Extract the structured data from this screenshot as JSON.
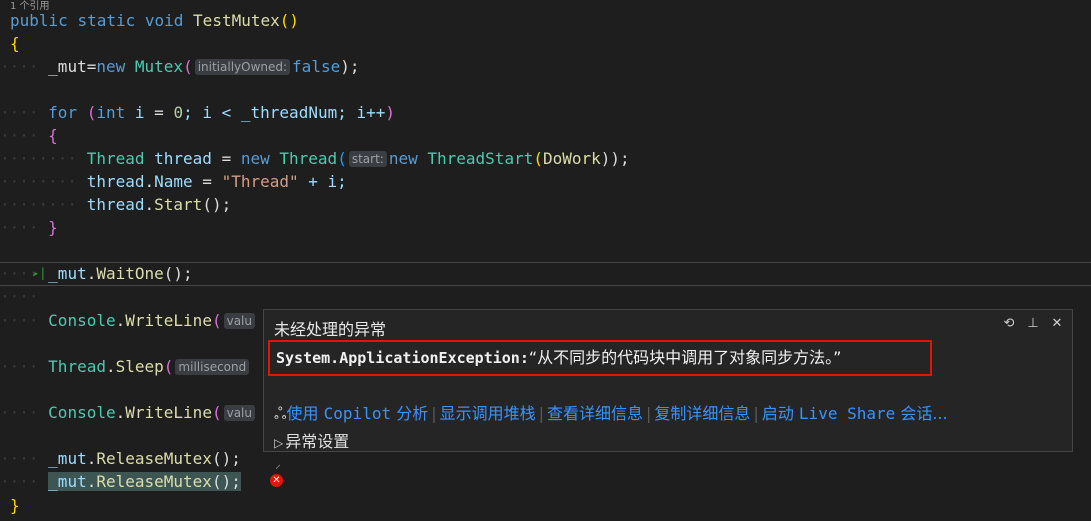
{
  "editor": {
    "references_label": "1 个引用",
    "method_decl": {
      "kw1": "public",
      "kw2": "static",
      "kw3": "void",
      "name": "TestMutex",
      "parens": "()"
    },
    "open_brace": "{",
    "line_mut": {
      "lhs": "_mut",
      "eq": "=",
      "kw": "new",
      "type": "Mutex",
      "open": "(",
      "hint": "initiallyOwned:",
      "arg": "false",
      "close": ");"
    },
    "line_for": {
      "kw": "for",
      "open": "(",
      "kw2": "int",
      "rest1": "i",
      "eq": " = ",
      "num": "0",
      "rest2": "; i < _threadNum; i++",
      "close": ")"
    },
    "for_open": "{",
    "line_thread_new": {
      "type": "Thread",
      "var": "thread",
      "eq": " = ",
      "kw": "new",
      "type2": "Thread",
      "open": "(",
      "hint": "start:",
      "kw2": "new",
      "type3": "ThreadStart",
      "open2": "(",
      "fn": "DoWork",
      "close": "));"
    },
    "line_thread_name": {
      "var": "thread",
      "dot": ".",
      "prop": "Name",
      "eq": " = ",
      "str": "\"Thread\"",
      "rest": " + i;"
    },
    "line_thread_start": {
      "var": "thread",
      "dot": ".",
      "fn": "Start",
      "rest": "();"
    },
    "for_close": "}",
    "line_waitone": {
      "var": "_mut",
      "dot": ".",
      "fn": "WaitOne",
      "rest": "();"
    },
    "line_console1": {
      "type": "Console",
      "dot": ".",
      "fn": "WriteLine",
      "open": "(",
      "hint": "valu"
    },
    "line_sleep": {
      "type": "Thread",
      "dot": ".",
      "fn": "Sleep",
      "open": "(",
      "hint": "millisecond"
    },
    "line_console2": {
      "type": "Console",
      "dot": ".",
      "fn": "WriteLine",
      "open": "(",
      "hint": "valu"
    },
    "line_release1": {
      "var": "_mut",
      "dot": ".",
      "fn": "ReleaseMutex",
      "rest": "();"
    },
    "line_release2": {
      "var": "_mut",
      "dot": ".",
      "fn": "ReleaseMutex",
      "rest": "();"
    },
    "close_brace": "}"
  },
  "popup": {
    "title": "未经处理的异常",
    "exception_type": "System.ApplicationException:",
    "exception_message": "“从不同步的代码块中调用了对象同步方法。”",
    "actions": {
      "copilot_prefix": "使用",
      "copilot_name": "Copilot",
      "copilot_suffix": "分析",
      "call_stack": "显示调用堆栈",
      "details": "查看详细信息",
      "copy_details": "复制详细信息",
      "live_share_prefix": "启动",
      "live_share_name": "Live Share",
      "live_share_suffix": "会话..."
    },
    "settings": "异常设置"
  },
  "icons": [
    "copilot-icon",
    "restore-icon",
    "pin-icon",
    "close-icon",
    "next-statement-arrow-icon",
    "error-icon",
    "expand-caret-icon"
  ],
  "colors": {
    "error_border": "#e51400",
    "link": "#3794ff",
    "keyword": "#569cd6",
    "type": "#4ec9b0"
  }
}
